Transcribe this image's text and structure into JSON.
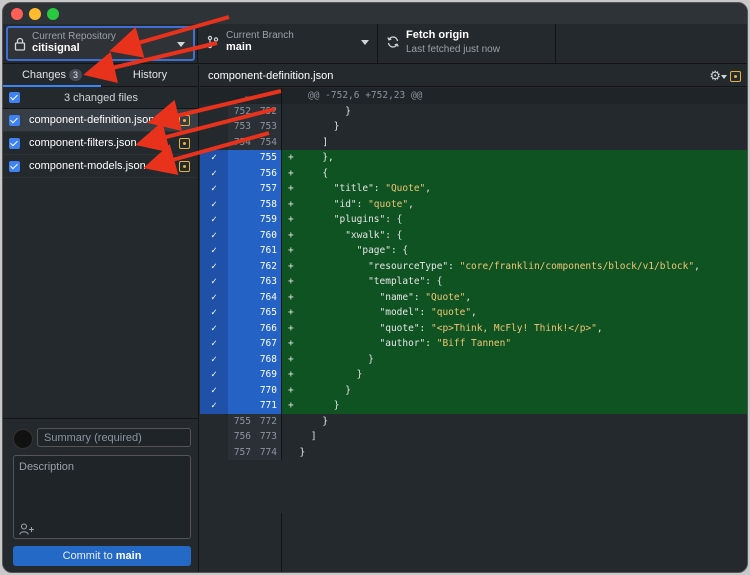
{
  "window": {
    "traffic_lights": [
      "close",
      "minimize",
      "zoom"
    ]
  },
  "toolbar": {
    "repo_label": "Current Repository",
    "repo_value": "citisignal",
    "branch_label": "Current Branch",
    "branch_value": "main",
    "fetch_label": "Fetch origin",
    "fetch_sub": "Last fetched just now"
  },
  "sidebar": {
    "tabs": {
      "changes": "Changes",
      "changes_count": "3",
      "history": "History"
    },
    "changed_files_label": "3 changed files",
    "files": [
      {
        "name": "component-definition.json"
      },
      {
        "name": "component-filters.json"
      },
      {
        "name": "component-models.json"
      }
    ],
    "summary_placeholder": "Summary (required)",
    "description_placeholder": "Description",
    "commit_prefix": "Commit to ",
    "commit_branch": "main"
  },
  "main": {
    "file_title": "component-definition.json",
    "hunk_header": "@@ -752,6 +752,23 @@",
    "hunk_old": "…",
    "lines": [
      {
        "type": "ctx",
        "old": "752",
        "new": "752",
        "text": "          }"
      },
      {
        "type": "ctx",
        "old": "753",
        "new": "753",
        "text": "        }"
      },
      {
        "type": "ctx",
        "old": "754",
        "new": "754",
        "text": "      ]"
      },
      {
        "type": "add",
        "old": "",
        "new": "755",
        "text": "+     },"
      },
      {
        "type": "add",
        "old": "",
        "new": "756",
        "text": "+     {"
      },
      {
        "type": "add",
        "old": "",
        "new": "757",
        "text": "+       \"title\": \"Quote\","
      },
      {
        "type": "add",
        "old": "",
        "new": "758",
        "text": "+       \"id\": \"quote\","
      },
      {
        "type": "add",
        "old": "",
        "new": "759",
        "text": "+       \"plugins\": {"
      },
      {
        "type": "add",
        "old": "",
        "new": "760",
        "text": "+         \"xwalk\": {"
      },
      {
        "type": "add",
        "old": "",
        "new": "761",
        "text": "+           \"page\": {"
      },
      {
        "type": "add",
        "old": "",
        "new": "762",
        "text": "+             \"resourceType\": \"core/franklin/components/block/v1/block\","
      },
      {
        "type": "add",
        "old": "",
        "new": "763",
        "text": "+             \"template\": {"
      },
      {
        "type": "add",
        "old": "",
        "new": "764",
        "text": "+               \"name\": \"Quote\","
      },
      {
        "type": "add",
        "old": "",
        "new": "765",
        "text": "+               \"model\": \"quote\","
      },
      {
        "type": "add",
        "old": "",
        "new": "766",
        "text": "+               \"quote\": \"<p>Think, McFly! Think!</p>\","
      },
      {
        "type": "add",
        "old": "",
        "new": "767",
        "text": "+               \"author\": \"Biff Tannen\""
      },
      {
        "type": "add",
        "old": "",
        "new": "768",
        "text": "+             }"
      },
      {
        "type": "add",
        "old": "",
        "new": "769",
        "text": "+           }"
      },
      {
        "type": "add",
        "old": "",
        "new": "770",
        "text": "+         }"
      },
      {
        "type": "add",
        "old": "",
        "new": "771",
        "text": "+       }"
      },
      {
        "type": "ctx",
        "old": "755",
        "new": "772",
        "text": "      }"
      },
      {
        "type": "ctx",
        "old": "756",
        "new": "773",
        "text": "    ]"
      },
      {
        "type": "ctx",
        "old": "757",
        "new": "774",
        "text": "  }"
      }
    ]
  },
  "colors": {
    "accent": "#2463c5",
    "added_bg": "#0f5323",
    "annotation_arrow": "#e8321c",
    "modified_icon": "#e3b341"
  },
  "icons": [
    "lock-icon",
    "branch-icon",
    "sync-icon",
    "gear-icon",
    "modified-file-icon",
    "add-coauthor-icon"
  ]
}
